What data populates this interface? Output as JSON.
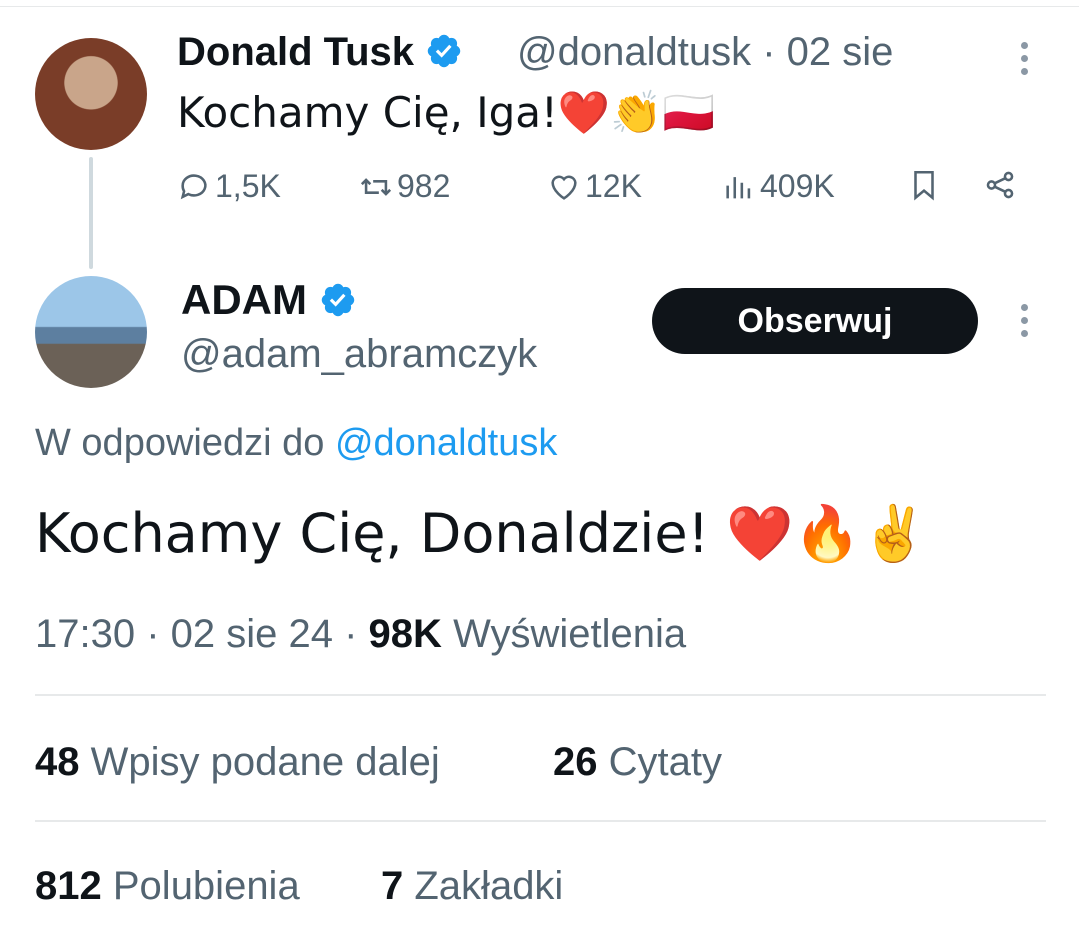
{
  "parent_tweet": {
    "author_name": "Donald Tusk",
    "handle_date": "@donaldtusk · 02 sie",
    "text": "Kochamy Cię, Iga!❤️👏🇵🇱",
    "stats": {
      "replies": "1,5K",
      "reposts": "982",
      "likes": "12K",
      "views": "409K"
    }
  },
  "main_tweet": {
    "author_name": "ADAM",
    "handle": "@adam_abramczyk",
    "follow_label": "Obserwuj",
    "reply_prefix": "W odpowiedzi do",
    "reply_mention": "@donaldtusk",
    "text": "Kochamy Cię, Donaldzie! ❤️🔥✌️",
    "timestamp": "17:30 · 02 sie 24 ·",
    "views_count": "98K",
    "views_label": "Wyświetlenia",
    "reposts_count": "48",
    "reposts_label": "Wpisy podane dalej",
    "quotes_count": "26",
    "quotes_label": "Cytaty",
    "likes_count": "812",
    "likes_label": "Polubienia",
    "bookmarks_count": "7",
    "bookmarks_label": "Zakładki"
  },
  "colors": {
    "accent": "#1d9bf0",
    "text": "#0f1419",
    "secondary": "#536471"
  }
}
